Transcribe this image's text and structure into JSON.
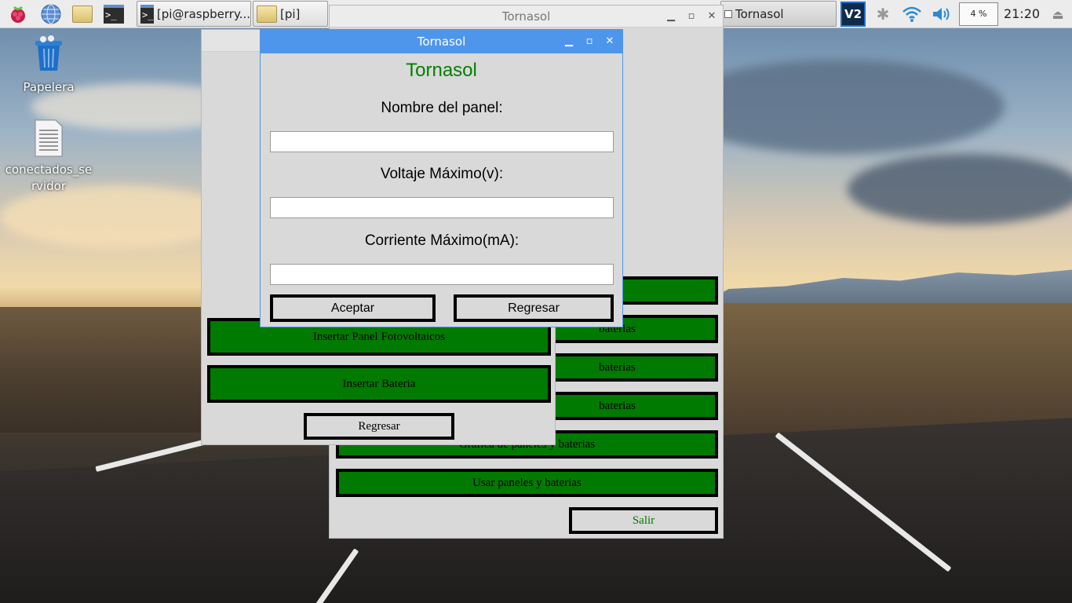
{
  "taskbar": {
    "tasks": [
      {
        "label": "[pi@raspberry..."
      },
      {
        "label": "[pi]"
      },
      {
        "label": "Tornasol"
      }
    ],
    "cpu": "4 %",
    "clock": "21:20"
  },
  "desktop": {
    "icons": [
      {
        "label": "Papelera"
      },
      {
        "label": "conectados_se rvidor"
      }
    ]
  },
  "back_window": {
    "title": "Tornasol",
    "buttons": [
      {
        "label": "baterias"
      },
      {
        "label": "baterias"
      },
      {
        "label": "baterias"
      },
      {
        "label": "Grafica de paneles y baterias"
      },
      {
        "label": "Usar paneles y baterias"
      }
    ],
    "exit_label": "Salir"
  },
  "middle_window": {
    "buttons": [
      {
        "label": "Insertar Panel Fotovoltaicos"
      },
      {
        "label": "Insertar Bateria"
      }
    ],
    "back_label": "Regresar"
  },
  "dialog": {
    "title": "Tornasol",
    "heading": "Tornasol",
    "fields": [
      {
        "label": "Nombre del panel:",
        "value": ""
      },
      {
        "label": "Voltaje Máximo(v):",
        "value": ""
      },
      {
        "label": "Corriente Máximo(mA):",
        "value": ""
      }
    ],
    "accept_label": "Aceptar",
    "back_label": "Regresar"
  },
  "colors": {
    "accent": "#4e96ec",
    "green_button": "#007a00",
    "heading_green": "#008000"
  }
}
